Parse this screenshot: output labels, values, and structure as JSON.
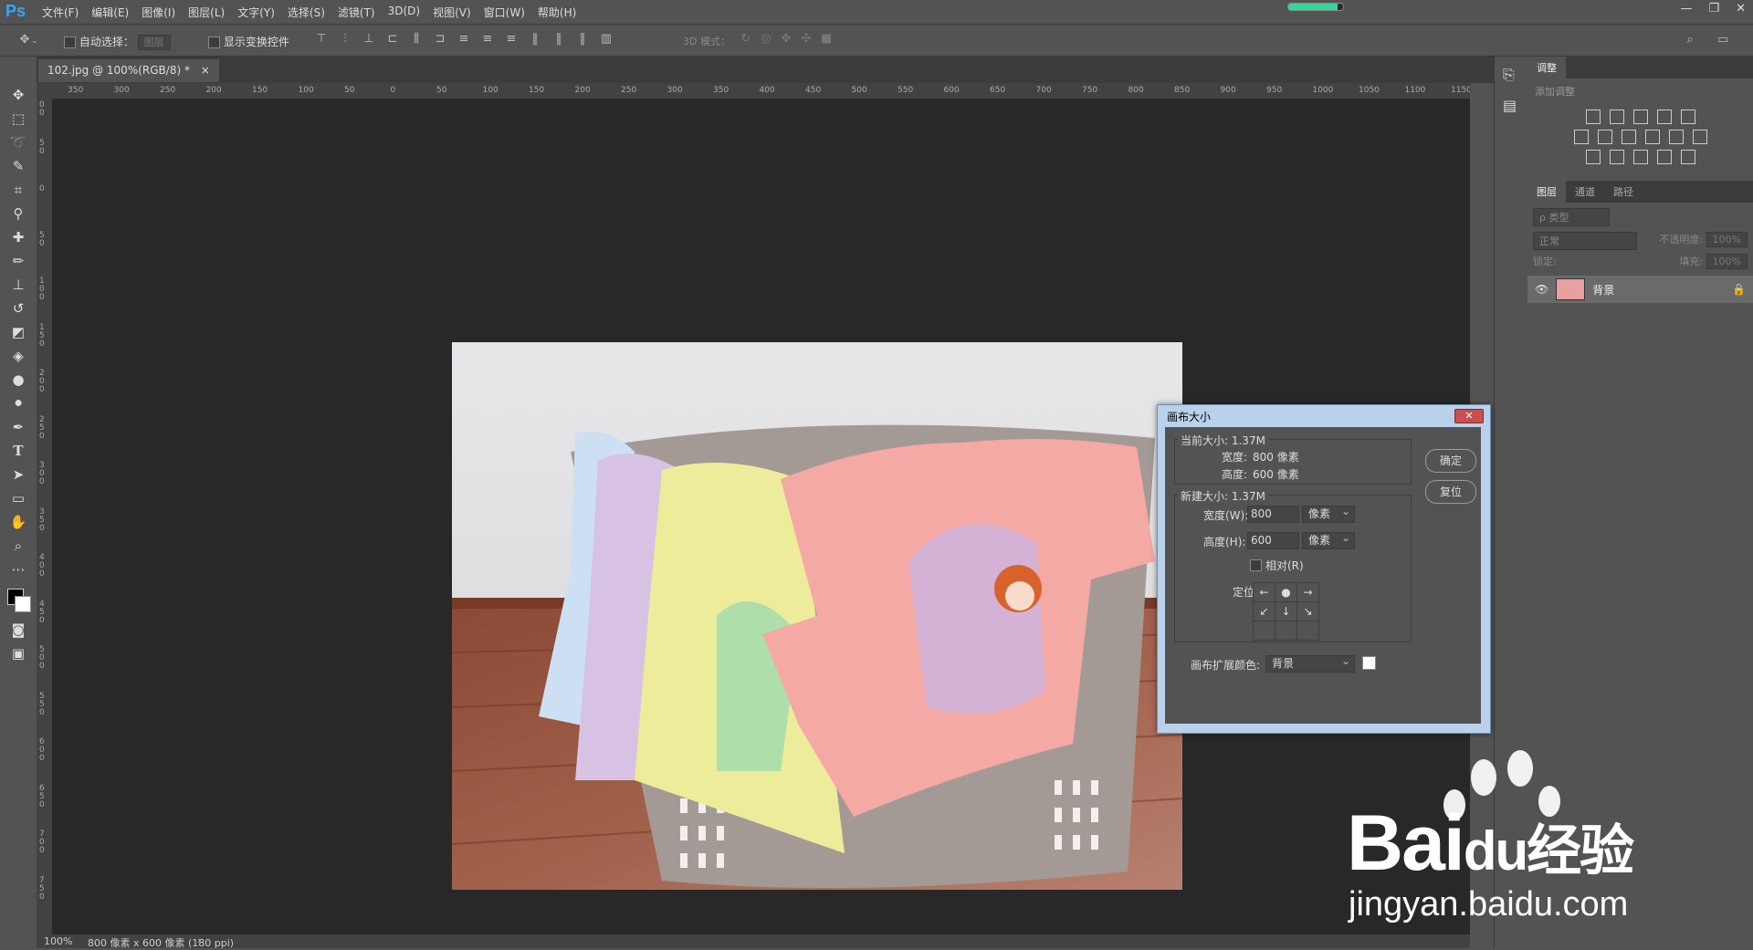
{
  "app": {
    "logo": "Ps"
  },
  "menu": [
    "文件(F)",
    "编辑(E)",
    "图像(I)",
    "图层(L)",
    "文字(Y)",
    "选择(S)",
    "滤镜(T)",
    "3D(D)",
    "视图(V)",
    "窗口(W)",
    "帮助(H)"
  ],
  "progress": 0.9,
  "options": {
    "auto_select_label": "自动选择：",
    "auto_select_value": "图层",
    "show_transform_label": "显示变换控件",
    "mode_3d_label": "3D 模式："
  },
  "document": {
    "tab_label": "102.jpg @ 100%(RGB/8) *",
    "zoom": "100%",
    "status": "800 像素 x 600 像素 (180 ppi)"
  },
  "ruler": {
    "h_ticks": [
      "350",
      "300",
      "250",
      "200",
      "150",
      "100",
      "50",
      "0",
      "50",
      "100",
      "150",
      "200",
      "250",
      "300",
      "350",
      "400",
      "450",
      "500",
      "550",
      "600",
      "650",
      "700",
      "750",
      "800",
      "850",
      "900",
      "950",
      "1000",
      "1050",
      "1100",
      "1150"
    ],
    "v_ticks": [
      "100",
      "50",
      "0",
      "50",
      "100",
      "150",
      "200",
      "250",
      "300",
      "350",
      "400",
      "450",
      "500",
      "550",
      "600",
      "650",
      "700",
      "750"
    ]
  },
  "panels": {
    "adjust_tab": "调整",
    "adjust_subtitle": "添加调整",
    "layer_tabs": [
      "图层",
      "通道",
      "路径"
    ],
    "layer_filter": "ρ 类型",
    "blend_mode": "正常",
    "opacity_label": "不透明度:",
    "opacity_value": "100%",
    "lock_label": "锁定:",
    "fill_label": "填充:",
    "fill_value": "100%",
    "layer_name": "背景"
  },
  "dialog": {
    "title": "画布大小",
    "close": "✕",
    "current_size": "当前大小: 1.37M",
    "current_width_label": "宽度:",
    "current_width": "800 像素",
    "current_height_label": "高度:",
    "current_height": "600 像素",
    "new_size": "新建大小: 1.37M",
    "width_label": "宽度(W):",
    "width_value": "800",
    "width_unit": "像素",
    "height_label": "高度(H):",
    "height_value": "600",
    "height_unit": "像素",
    "relative_label": "相对(R)",
    "anchor_label": "定位:",
    "ext_color_label": "画布扩展颜色:",
    "ext_color_value": "背景",
    "ok": "确定",
    "reset": "复位",
    "anchor_glyphs": [
      "←",
      "●",
      "→",
      "↙",
      "↓",
      "↘",
      "",
      "",
      ""
    ]
  },
  "watermark": {
    "brand": "Bai",
    "brand2": "du",
    "cn": "经验",
    "url": "jingyan.baidu.com"
  }
}
